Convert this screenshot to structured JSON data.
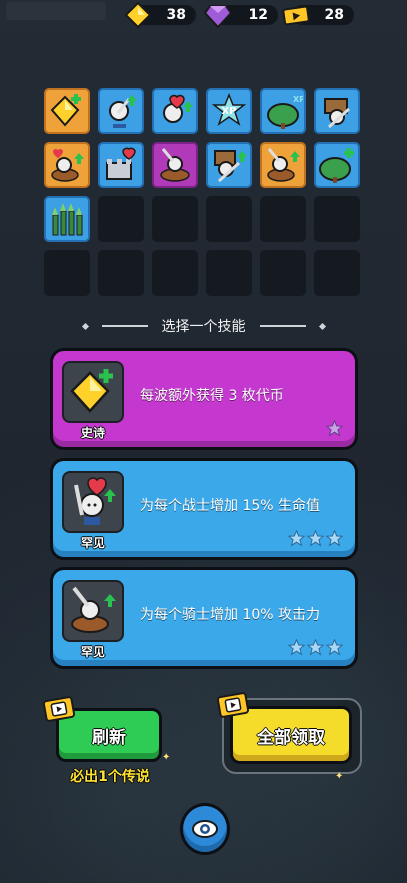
{
  "currencies": [
    {
      "name": "gold",
      "value": "38",
      "color": "#f5c518"
    },
    {
      "name": "gem",
      "value": "12",
      "color": "#a05bd9"
    },
    {
      "name": "ticket",
      "value": "28",
      "color": "#f5c518"
    }
  ],
  "skill_grid": {
    "owned": [
      {
        "icon": "gold-coin-plus-icon",
        "rarity": "orange"
      },
      {
        "icon": "warrior-sword-up-icon",
        "rarity": "blue"
      },
      {
        "icon": "warrior-heart-up-icon",
        "rarity": "blue"
      },
      {
        "icon": "xp-boost-icon",
        "rarity": "blue"
      },
      {
        "icon": "xp-tree-icon",
        "rarity": "blue"
      },
      {
        "icon": "archer-sword-icon",
        "rarity": "blue"
      },
      {
        "icon": "knight-heart-up-icon",
        "rarity": "orange"
      },
      {
        "icon": "castle-heart-icon",
        "rarity": "blue"
      },
      {
        "icon": "knight-rider-icon",
        "rarity": "purple"
      },
      {
        "icon": "archer-sword-up-icon",
        "rarity": "blue"
      },
      {
        "icon": "knight-sword-up-icon",
        "rarity": "orange"
      },
      {
        "icon": "tree-plus-icon",
        "rarity": "blue"
      },
      {
        "icon": "spear-fence-icon",
        "rarity": "blue"
      }
    ],
    "total_slots": 24
  },
  "section_title": "选择一个技能",
  "skill_cards": [
    {
      "rarity_label": "史诗",
      "description": "每波额外获得 3 枚代币",
      "tier": "epic",
      "icon": "gold-coin-plus-icon",
      "stars": 1
    },
    {
      "rarity_label": "罕见",
      "description": "为每个战士增加 15% 生命值",
      "tier": "rare",
      "icon": "warrior-heart-up-icon",
      "stars": 3
    },
    {
      "rarity_label": "罕见",
      "description": "为每个骑士增加 10% 攻击力",
      "tier": "rare",
      "icon": "knight-sword-up-icon",
      "stars": 3
    }
  ],
  "buttons": {
    "refresh_label": "刷新",
    "claim_all_label": "全部领取",
    "guarantee_text": "必出1个传说"
  },
  "colors": {
    "epic": "#c538cf",
    "rare": "#3ba8ea",
    "refresh": "#2fcc55",
    "claim": "#f5dc2a"
  }
}
